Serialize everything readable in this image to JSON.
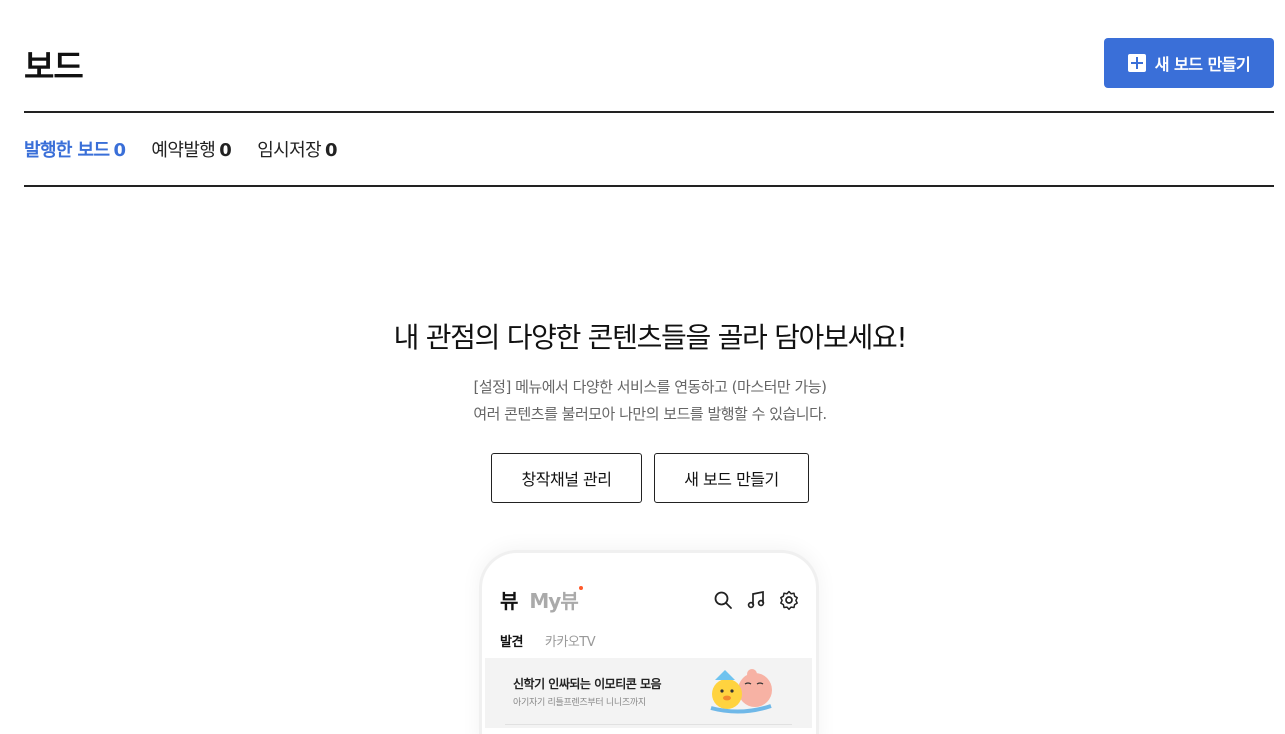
{
  "header": {
    "title": "보드",
    "new_board_label": "새 보드 만들기",
    "accent": "#3a6fd8"
  },
  "tabs": [
    {
      "label": "발행한 보드",
      "count": "0",
      "active": true
    },
    {
      "label": "예약발행",
      "count": "0",
      "active": false
    },
    {
      "label": "임시저장",
      "count": "0",
      "active": false
    }
  ],
  "empty_state": {
    "heading": "내 관점의 다양한 콘텐츠들을 골라 담아보세요!",
    "desc_line1": "[설정] 메뉴에서 다양한 서비스를 연동하고 (마스터만 가능)",
    "desc_line2": "여러 콘텐츠를 불러모아 나만의 보드를 발행할 수 있습니다.",
    "btn_channel": "창작채널 관리",
    "btn_new_board": "새 보드 만들기"
  },
  "phone_preview": {
    "logo": "뷰",
    "myview": "My뷰",
    "icons": [
      "search-icon",
      "music-note-icon",
      "gear-icon"
    ],
    "tabs": [
      "발견",
      "카카오TV"
    ],
    "card_title": "신학기 인싸되는 이모티콘 모음",
    "card_subtitle": "아기자기 리틀프렌즈부터 니니즈까지"
  }
}
